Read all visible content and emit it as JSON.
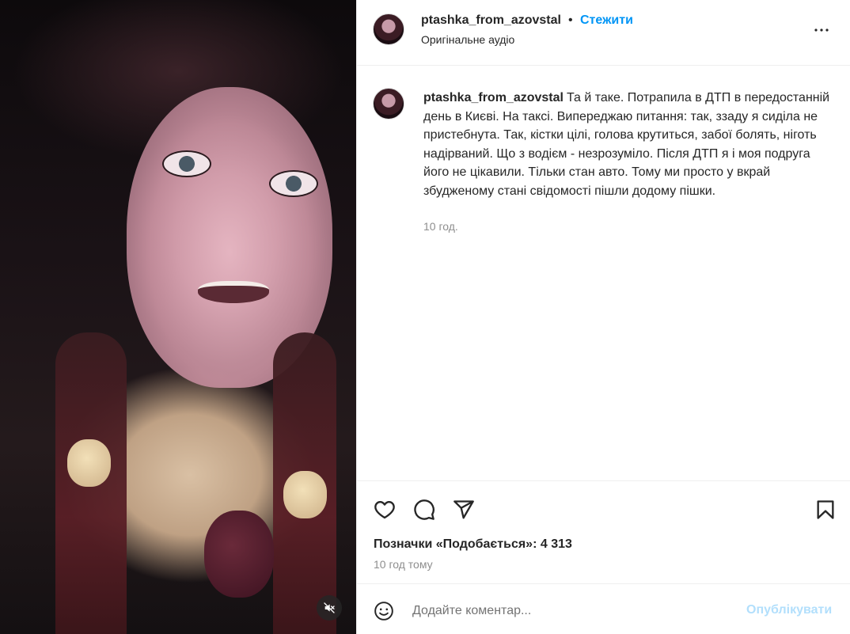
{
  "header": {
    "username": "ptashka_from_azovstal",
    "separator": "•",
    "follow_label": "Стежити",
    "audio_label": "Оригінальне аудіо"
  },
  "caption": {
    "username": "ptashka_from_azovstal",
    "text": "Та й таке. Потрапила в ДТП в передостанній день в Києві. На таксі. Випереджаю питання: так, ззаду я сиділа не пристебнута. Так, кістки цілі, голова крутиться, забої болять, ніготь надірваний. Що з водієм - незрозуміло. Після ДТП я і моя подруга його не цікавили. Тільки стан авто. Тому ми просто у вкрай збудженому стані свідомості пішли додому пішки.",
    "time": "10 год."
  },
  "actions": {
    "likes_label": "Позначки «Подобається»: 4 313",
    "date": "10 год тому",
    "icons": [
      "heart-icon",
      "comment-icon",
      "share-icon",
      "bookmark-icon"
    ]
  },
  "comment": {
    "placeholder": "Додайте коментар...",
    "publish_label": "Опублікувати"
  },
  "media": {
    "mute_icon": "speaker-muted-icon"
  },
  "colors": {
    "link_blue": "#0095f6",
    "disabled_blue": "#b2dffc",
    "text": "#262626",
    "secondary": "#8e8e8e"
  }
}
